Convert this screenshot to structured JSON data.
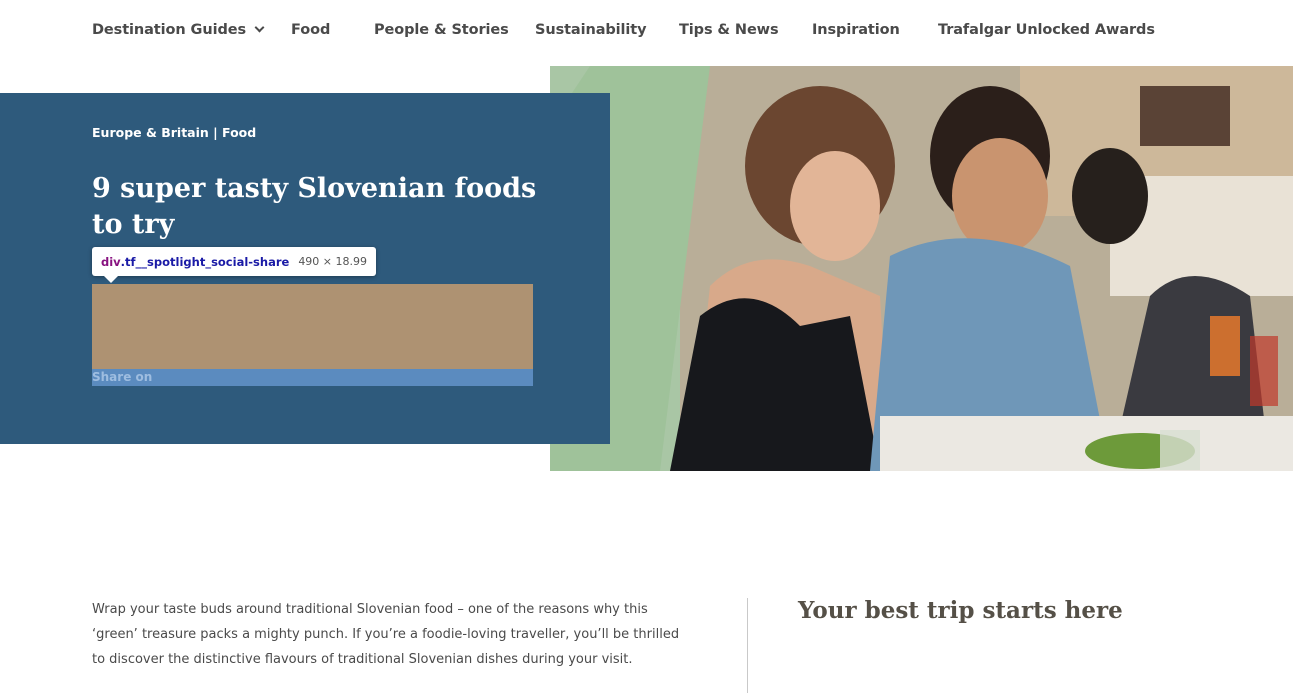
{
  "nav": {
    "items": [
      {
        "label": "Destination Guides",
        "has_dropdown": true
      },
      {
        "label": "Food"
      },
      {
        "label": "People & Stories"
      },
      {
        "label": "Sustainability"
      },
      {
        "label": "Tips & News"
      },
      {
        "label": "Inspiration"
      },
      {
        "label": "Trafalgar Unlocked Awards"
      }
    ]
  },
  "hero": {
    "breadcrumb": "Europe & Britain | Food",
    "title": "9 super tasty Slovenian foods to try",
    "share_label": "Share on",
    "colors": {
      "panel": "#2e5a7c",
      "margin_overlay": "#ae9272",
      "content_overlay": "#5b8bbf"
    }
  },
  "devtools_tooltip": {
    "tag": "div",
    "class": ".tf__spotlight_social-share",
    "dimensions": "490 × 18.99"
  },
  "article": {
    "intro": "Wrap your taste buds around traditional Slovenian food – one of the reasons why this ‘green’ treasure packs a mighty punch. If you’re a foodie-loving traveller, you’ll be thrilled to discover the distinctive flavours of traditional Slovenian dishes during your visit."
  },
  "sidebar": {
    "heading": "Your best trip starts here"
  }
}
